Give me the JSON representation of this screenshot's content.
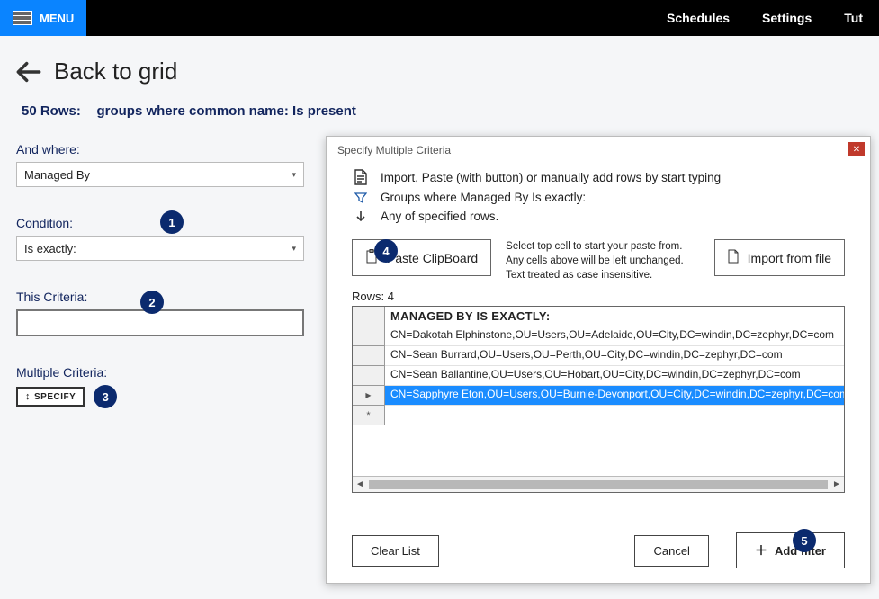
{
  "topbar": {
    "menu_label": "MENU",
    "nav": [
      "Schedules",
      "Settings",
      "Tut"
    ]
  },
  "page": {
    "back_label": "Back to grid",
    "row_count_label": "50 Rows:",
    "query_text": "groups where common name: Is present"
  },
  "filters": {
    "and_where_label": "And where:",
    "and_where_value": "Managed By",
    "condition_label": "Condition:",
    "condition_value": "Is exactly:",
    "this_criteria_label": "This Criteria:",
    "this_criteria_value": "",
    "multiple_criteria_label": "Multiple Criteria:",
    "specify_btn": "SPECIFY"
  },
  "callouts": {
    "c1": "1",
    "c2": "2",
    "c3": "3",
    "c4": "4",
    "c5": "5"
  },
  "dialog": {
    "title": "Specify Multiple Criteria",
    "line1": "Import, Paste (with button) or manually add rows by start typing",
    "line2": "Groups where Managed By Is exactly:",
    "line3": "Any of specified rows.",
    "paste_btn": "Paste ClipBoard",
    "help_text1": "Select top cell to start your paste from.",
    "help_text2": "Any cells above will be left unchanged.",
    "help_text3": "Text treated as case insensitive.",
    "import_btn": "Import from file",
    "rows_label": "Rows: 4",
    "column_header": "MANAGED BY IS EXACTLY:",
    "rows": [
      "CN=Dakotah Elphinstone,OU=Users,OU=Adelaide,OU=City,DC=windin,DC=zephyr,DC=com",
      "CN=Sean Burrard,OU=Users,OU=Perth,OU=City,DC=windin,DC=zephyr,DC=com",
      "CN=Sean Ballantine,OU=Users,OU=Hobart,OU=City,DC=windin,DC=zephyr,DC=com",
      "CN=Sapphyre Eton,OU=Users,OU=Burnie-Devonport,OU=City,DC=windin,DC=zephyr,DC=com"
    ],
    "selected_row_index": 3,
    "clear_btn": "Clear List",
    "cancel_btn": "Cancel",
    "add_filter_btn": "Add filter"
  }
}
